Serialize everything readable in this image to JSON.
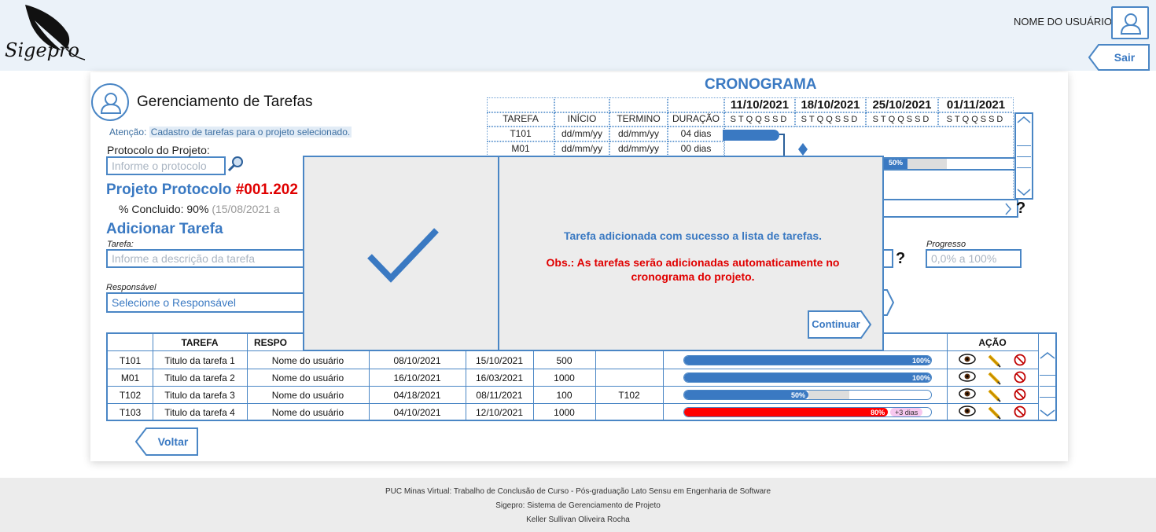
{
  "header": {
    "logo_text": "Sigepro",
    "username": "NOME DO USUÁRIO",
    "logout_label": "Sair"
  },
  "page": {
    "title": "Gerenciamento de Tarefas",
    "attention_label": "Atenção:",
    "attention_text": "Cadastro de tarefas para o projeto selecionado.",
    "protocol_label": "Protocolo do Projeto:",
    "protocol_placeholder": "Informe o protocolo",
    "project_prefix": "Projeto Protocolo ",
    "project_number": "#001.202",
    "completed_label": "% Concluido:",
    "completed_value": "90%",
    "completed_date": "(15/08/2021 a",
    "add_title": "Adicionar Tarefa",
    "task_label": "Tarefa:",
    "task_placeholder": "Informe a descrição da tarefa",
    "responsible_label": "Responsável",
    "responsible_select": "Selecione o Responsável",
    "progress_label": "Progresso",
    "progress_placeholder": "0,0% a 100%",
    "help_mark": "?",
    "back_label": "Voltar"
  },
  "cronograma": {
    "title": "CRONOGRAMA",
    "weeks": [
      "11/10/2021",
      "18/10/2021",
      "25/10/2021",
      "01/11/2021"
    ],
    "day_letters": "STQQSSD",
    "columns": [
      "TAREFA",
      "INÍCIO",
      "TERMINO",
      "DURAÇÃO"
    ],
    "rows": [
      {
        "task": "T101",
        "start": "dd/mm/yy",
        "end": "dd/mm/yy",
        "duration": "04 dias"
      },
      {
        "task": "M01",
        "start": "dd/mm/yy",
        "end": "dd/mm/yy",
        "duration": "00 dias"
      }
    ],
    "bar_label": "50%",
    "bar_progress": 0.5
  },
  "table": {
    "headers": [
      "TAREFA",
      "RESPO",
      "AÇÃO"
    ],
    "rows": [
      {
        "id": "T101",
        "task": "Titulo da tarefa 1",
        "responsible": "Nome do usuário",
        "start": "08/10/2021",
        "end": "15/10/2021",
        "value": "500",
        "dep": "",
        "progress_label": "100%",
        "progress": 1.0,
        "late": "",
        "color": "#3a79c2"
      },
      {
        "id": "M01",
        "task": "Titulo da tarefa 2",
        "responsible": "Nome do usuário",
        "start": "16/10/2021",
        "end": "16/03/2021",
        "value": "1000",
        "dep": "",
        "progress_label": "100%",
        "progress": 1.0,
        "late": "",
        "color": "#3a79c2"
      },
      {
        "id": "T102",
        "task": "Titulo da tarefa 3",
        "responsible": "Nome do usuário",
        "start": "04/18/2021",
        "end": "08/11/2021",
        "value": "100",
        "dep": "T102",
        "progress_label": "50%",
        "progress": 0.5,
        "late": "",
        "color": "#3a79c2"
      },
      {
        "id": "T103",
        "task": "Titulo da tarefa 4",
        "responsible": "Nome do usuário",
        "start": "04/10/2021",
        "end": "12/10/2021",
        "value": "1000",
        "dep": "",
        "progress_label": "80%",
        "progress": 0.8,
        "late": "+3 dias",
        "color": "#ff0000"
      }
    ]
  },
  "modal": {
    "message": "Tarefa adicionada com sucesso a lista de tarefas.",
    "obs_line1": "Obs.: As tarefas serão adicionadas automaticamente no",
    "obs_line2": "cronograma do projeto.",
    "continue_label": "Continuar"
  },
  "footer": {
    "line1": "PUC Minas Virtual: Trabalho de Conclusão de Curso - Pós-graduação Lato Sensu em Engenharia de Software",
    "line2": "Sigepro: Sistema de Gerenciamento de Projeto",
    "line3": "Keller Sullivan Oliveira Rocha"
  },
  "colors": {
    "accent": "#3a79c2",
    "danger": "#e00000",
    "header_bg": "#ebf2f9",
    "modal_bg": "#ececec"
  }
}
